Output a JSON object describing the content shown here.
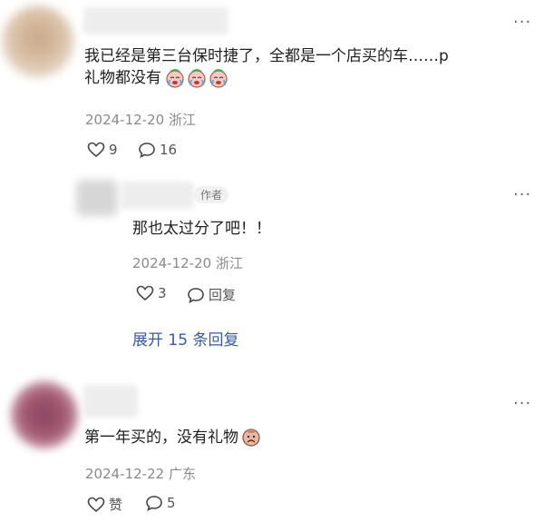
{
  "comments": [
    {
      "text_line1": "我已经是第三台保时捷了，全都是一个店买的车……p",
      "text_line2": "礼物都没有",
      "meta": "2024-12-20 浙江",
      "likes": "9",
      "replies": "16",
      "more": "···",
      "avatar_color": "#c9a88a"
    },
    {
      "badge": "作者",
      "text": "那也太过分了吧！！",
      "meta": "2024-12-20 浙江",
      "likes": "3",
      "reply_label": "回复",
      "more": "···",
      "avatar_color": "#cfcfcf"
    },
    {
      "text": "第一年买的，没有礼物",
      "meta": "2024-12-22 广东",
      "like_label": "赞",
      "replies": "5",
      "more": "···",
      "avatar_color": "#a0566e"
    }
  ],
  "expand_replies": "展开 15 条回复"
}
